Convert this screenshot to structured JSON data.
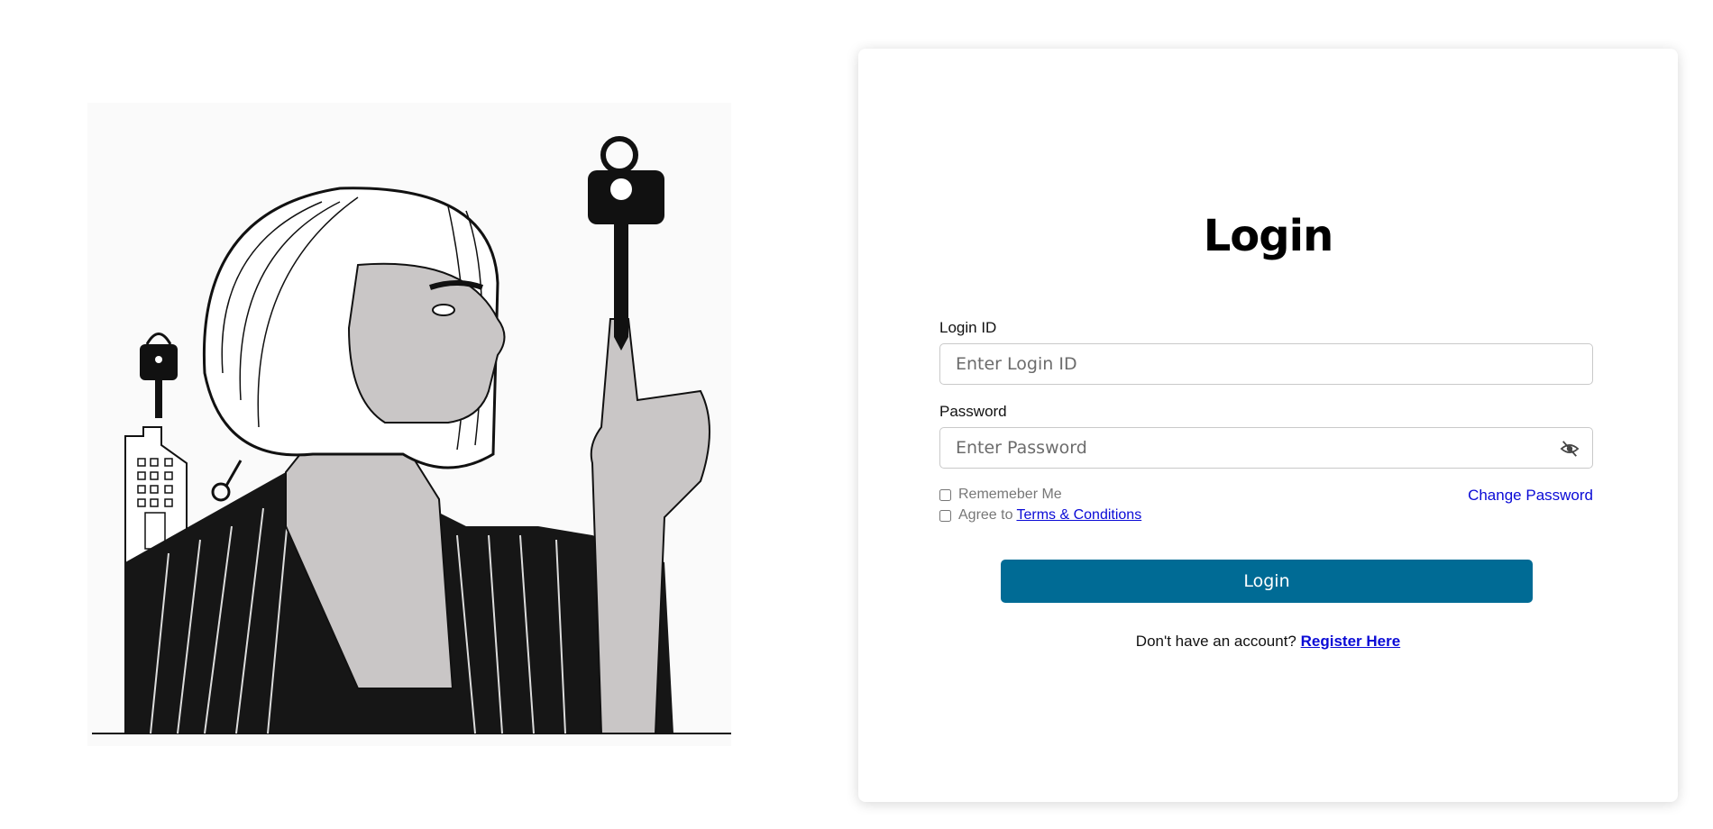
{
  "login": {
    "title": "Login",
    "login_id_label": "Login ID",
    "login_id_placeholder": "Enter Login ID",
    "password_label": "Password",
    "password_placeholder": "Enter Password",
    "remember_label": "Rememeber Me",
    "agree_prefix": "Agree to",
    "terms_link": "Terms & Conditions",
    "change_password": "Change Password",
    "login_button": "Login",
    "register_prompt": "Don't have an account?",
    "register_link": "Register Here"
  },
  "icons": {
    "password_toggle": "eye-off-icon",
    "illustration": "woman-holding-key-illustration"
  },
  "colors": {
    "primary_button": "#006b95",
    "link": "#0a0ad6"
  }
}
